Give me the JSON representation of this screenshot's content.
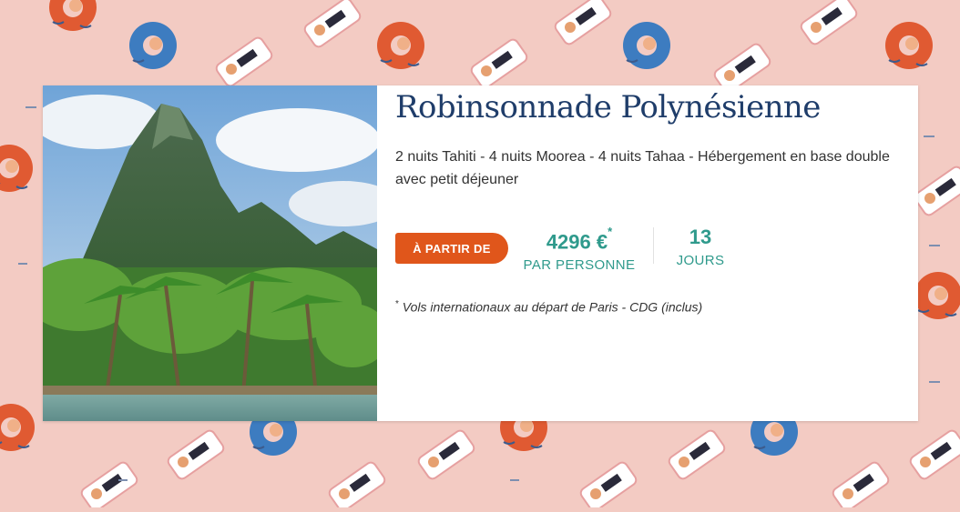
{
  "offer": {
    "title": "Robinsonnade Polynésienne",
    "description": "2 nuits Tahiti - 4 nuits Moorea - 4 nuits Tahaa - Hébergement en base double avec petit déjeuner",
    "from_label": "À PARTIR DE",
    "price": "4296 €",
    "price_marker": "*",
    "price_unit": "PAR PERSONNE",
    "duration": "13",
    "duration_unit": "JOURS",
    "note_marker": "*",
    "note": "Vols internationaux au départ de Paris - CDG (inclus)"
  },
  "icons": {
    "photo": "tropical-island-photo",
    "background": "swimmer-pattern"
  },
  "colors": {
    "background": "#f3cbc3",
    "title": "#1f3d6a",
    "accent": "#e0561b",
    "teal": "#2f9a8c"
  }
}
